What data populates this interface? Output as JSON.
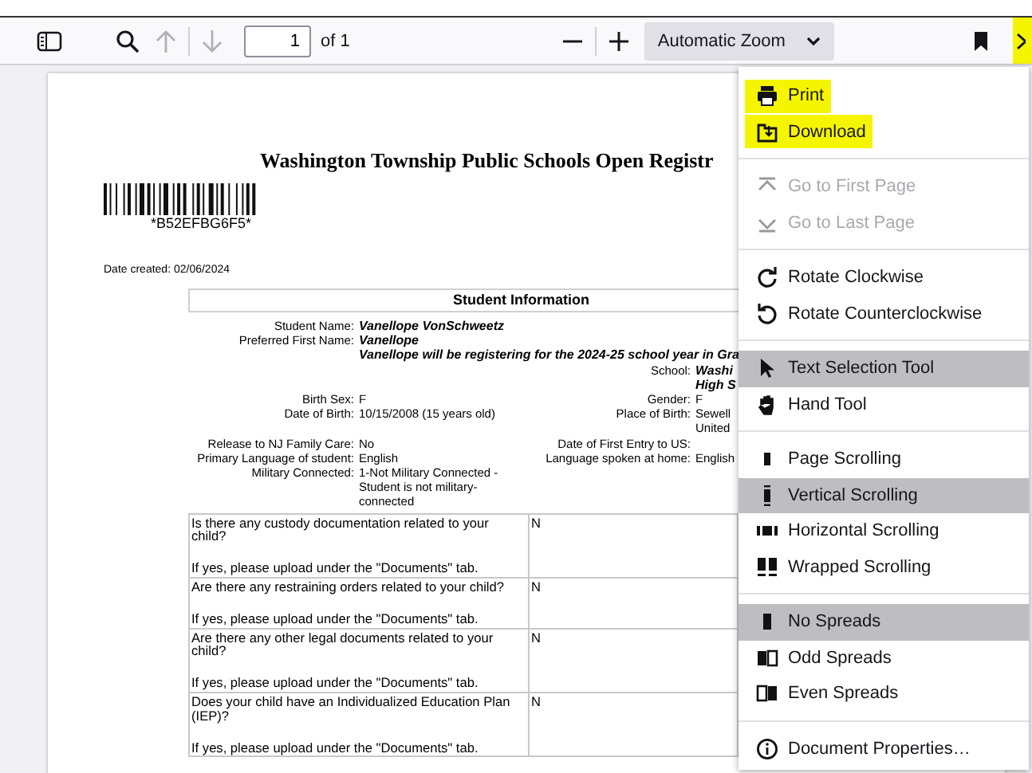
{
  "toolbar": {
    "page_number": "1",
    "page_count": "of 1",
    "zoom": "Automatic Zoom",
    "tools_button": {
      "highlighted": true
    }
  },
  "document": {
    "title": "Washington Township Public Schools Open Registr",
    "barcode_text": "*B52EFBG6F5*",
    "date_created": "Date created: 02/06/2024",
    "section_title": "Student Information",
    "fields": [
      {
        "left": {
          "label": "Student Name:",
          "lines": [
            "Vanellope VonSchweetz"
          ],
          "emphasis": true
        }
      },
      {
        "left": {
          "label": "Preferred First Name:",
          "lines": [
            "Vanellope"
          ],
          "emphasis": true
        }
      },
      {
        "left": {
          "lines": [
            "Vanellope will be registering for the 2024-25 school year in Gra"
          ],
          "emphasis": true
        }
      },
      {
        "right": {
          "label": "School:",
          "lines": [
            "Washi",
            "High S"
          ],
          "emphasis": true
        }
      },
      {
        "left": {
          "label": "Birth Sex:",
          "lines": [
            "F"
          ],
          "emphasis": false
        },
        "right": {
          "label": "Gender:",
          "lines": [
            "F"
          ],
          "emphasis": false
        }
      },
      {
        "left": {
          "label": "Date of Birth:",
          "lines": [
            "10/15/2008 (15 years old)"
          ],
          "emphasis": false
        },
        "right": {
          "label": "Place of Birth:",
          "lines": [
            "Sewell",
            "United"
          ],
          "emphasis": false
        }
      },
      {
        "left": {
          "label": "Release to NJ Family Care:",
          "lines": [
            "No"
          ],
          "emphasis": false
        },
        "right": {
          "label": "Date of First Entry to US:"
        }
      },
      {
        "left": {
          "label": "Primary Language of student:",
          "lines": [
            "English"
          ],
          "emphasis": false
        },
        "right": {
          "label": "Language spoken at home:",
          "lines": [
            "English"
          ],
          "emphasis": false
        }
      },
      {
        "left": {
          "label": "Military Connected:",
          "lines": [
            "1-Not Military Connected -",
            "Student is not military-",
            "connected"
          ],
          "emphasis": false
        }
      }
    ],
    "questions": [
      {
        "question": "Is there any custody documentation related to your child?",
        "note": "If yes, please upload under the \"Documents\" tab.",
        "answer": "N"
      },
      {
        "question": "Are there any restraining orders related to your child?",
        "note": "If yes, please upload under the \"Documents\" tab.",
        "answer": "N"
      },
      {
        "question": "Are there any other legal documents related to your child?",
        "note": "If yes, please upload under the \"Documents\" tab.",
        "answer": "N"
      },
      {
        "question": "Does your child have an Individualized Education Plan (IEP)?",
        "note": "If yes, please upload under the \"Documents\" tab.",
        "answer": "N"
      }
    ]
  },
  "menu": {
    "groups": [
      {
        "items": [
          {
            "label": "Print",
            "selected": false,
            "disabled": false,
            "highlighted": true
          },
          {
            "label": "Download",
            "selected": false,
            "disabled": false,
            "highlighted": true
          }
        ]
      },
      {
        "items": [
          {
            "label": "Go to First Page",
            "selected": false,
            "disabled": true,
            "highlighted": false
          },
          {
            "label": "Go to Last Page",
            "selected": false,
            "disabled": true,
            "highlighted": false
          }
        ]
      },
      {
        "items": [
          {
            "label": "Rotate Clockwise",
            "selected": false,
            "disabled": false,
            "highlighted": false
          },
          {
            "label": "Rotate Counterclockwise",
            "selected": false,
            "disabled": false,
            "highlighted": false
          }
        ]
      },
      {
        "items": [
          {
            "label": "Text Selection Tool",
            "selected": true,
            "disabled": false,
            "highlighted": false
          },
          {
            "label": "Hand Tool",
            "selected": false,
            "disabled": false,
            "highlighted": false
          }
        ]
      },
      {
        "items": [
          {
            "label": "Page Scrolling",
            "selected": false,
            "disabled": false,
            "highlighted": false
          },
          {
            "label": "Vertical Scrolling",
            "selected": true,
            "disabled": false,
            "highlighted": false
          },
          {
            "label": "Horizontal Scrolling",
            "selected": false,
            "disabled": false,
            "highlighted": false
          },
          {
            "label": "Wrapped Scrolling",
            "selected": false,
            "disabled": false,
            "highlighted": false
          }
        ]
      },
      {
        "items": [
          {
            "label": "No Spreads",
            "selected": true,
            "disabled": false,
            "highlighted": false
          },
          {
            "label": "Odd Spreads",
            "selected": false,
            "disabled": false,
            "highlighted": false
          },
          {
            "label": "Even Spreads",
            "selected": false,
            "disabled": false,
            "highlighted": false
          }
        ]
      },
      {
        "items": [
          {
            "label": "Document Properties…",
            "selected": false,
            "disabled": false,
            "highlighted": false
          }
        ]
      }
    ]
  }
}
